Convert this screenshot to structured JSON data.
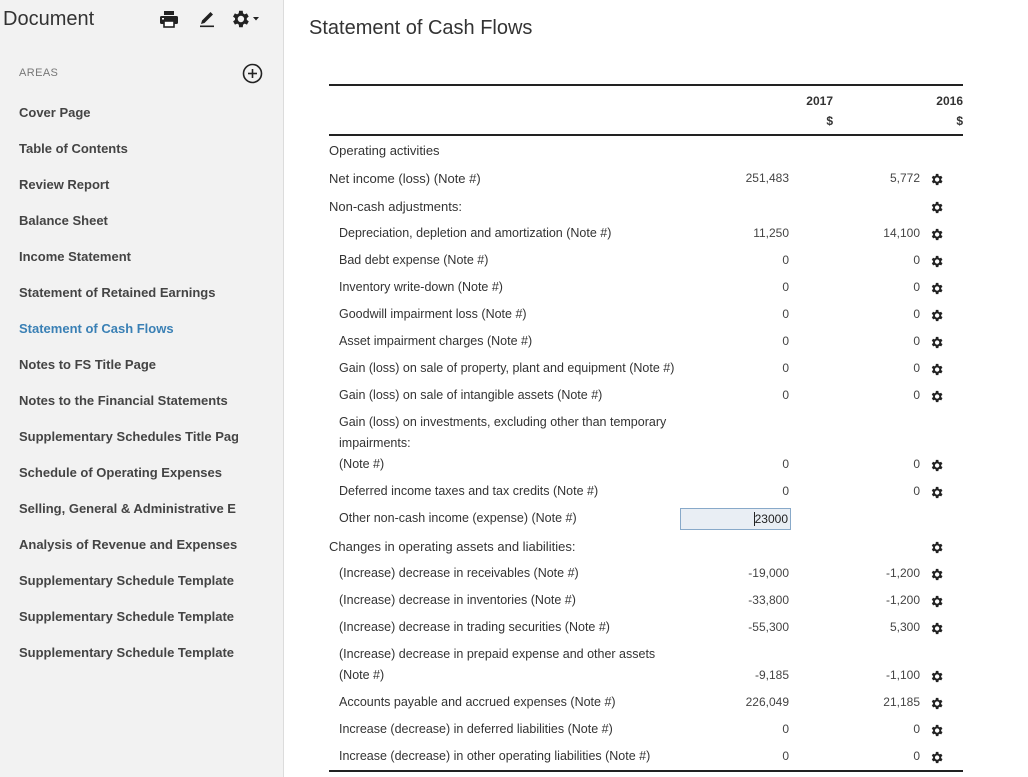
{
  "sidebar": {
    "title": "Document",
    "areas_label": "AREAS",
    "items": [
      {
        "label": "Cover Page"
      },
      {
        "label": "Table of Contents"
      },
      {
        "label": "Review Report"
      },
      {
        "label": "Balance Sheet"
      },
      {
        "label": "Income Statement"
      },
      {
        "label": "Statement of Retained Earnings"
      },
      {
        "label": "Statement of Cash Flows",
        "active": true
      },
      {
        "label": "Notes to FS Title Page"
      },
      {
        "label": "Notes to the Financial Statements"
      },
      {
        "label": "Supplementary Schedules Title Pag"
      },
      {
        "label": "Schedule of Operating Expenses"
      },
      {
        "label": "Selling, General & Administrative E"
      },
      {
        "label": "Analysis of Revenue and Expenses"
      },
      {
        "label": "Supplementary Schedule Template"
      },
      {
        "label": "Supplementary Schedule Template"
      },
      {
        "label": "Supplementary Schedule Template"
      }
    ],
    "icons": [
      "print-icon",
      "edit-pencil-icon",
      "settings-gear-icon",
      "add-circle-icon"
    ],
    "active_color": "#3a80b5"
  },
  "main": {
    "title": "Statement of Cash Flows",
    "columns": {
      "year1": "2017",
      "currency1": "$",
      "year2": "2016",
      "currency2": "$"
    },
    "rows": [
      {
        "label": "Operating activities",
        "v1": "",
        "v2": "",
        "gear": false
      },
      {
        "label": "Net income (loss) (Note #)",
        "v1": "251,483",
        "v2": "5,772",
        "gear": true
      },
      {
        "label": "Non-cash adjustments:",
        "v1": "",
        "v2": "",
        "gear": true
      },
      {
        "label": "Depreciation, depletion and amortization (Note #)",
        "v1": "11,250",
        "v2": "14,100",
        "gear": true
      },
      {
        "label": "Bad debt expense (Note #)",
        "v1": "0",
        "v2": "0",
        "gear": true
      },
      {
        "label": "Inventory write-down (Note #)",
        "v1": "0",
        "v2": "0",
        "gear": true
      },
      {
        "label": "Goodwill impairment loss (Note #)",
        "v1": "0",
        "v2": "0",
        "gear": true
      },
      {
        "label": "Asset impairment charges (Note #)",
        "v1": "0",
        "v2": "0",
        "gear": true
      },
      {
        "label": "Gain (loss) on sale of property, plant and equipment (Note #)",
        "v1": "0",
        "v2": "0",
        "gear": true
      },
      {
        "label": "Gain (loss) on sale of intangible assets (Note #)",
        "v1": "0",
        "v2": "0",
        "gear": true
      },
      {
        "label1": "Gain (loss) on investments, excluding other than temporary",
        "label2": "impairments:",
        "label3": "(Note #)",
        "v1": "0",
        "v2": "0",
        "gear": true
      },
      {
        "label": "Deferred income taxes and tax credits (Note #)",
        "v1": "0",
        "v2": "0",
        "gear": true
      },
      {
        "label": "Other non-cash income (expense) (Note #)",
        "edit_value": "23000",
        "v2": "",
        "gear": false
      },
      {
        "label": "Changes in operating assets and liabilities:",
        "v1": "",
        "v2": "",
        "gear": true
      },
      {
        "label": "(Increase) decrease in receivables (Note #)",
        "v1": "-19,000",
        "v2": "-1,200",
        "gear": true
      },
      {
        "label": "(Increase) decrease in inventories (Note #)",
        "v1": "-33,800",
        "v2": "-1,200",
        "gear": true
      },
      {
        "label": "(Increase) decrease in trading securities (Note #)",
        "v1": "-55,300",
        "v2": "5,300",
        "gear": true
      },
      {
        "label1": "(Increase) decrease in prepaid expense and other assets",
        "label2": "(Note #)",
        "v1": "-9,185",
        "v2": "-1,100",
        "gear": true
      },
      {
        "label": "Accounts payable and accrued expenses (Note #)",
        "v1": "226,049",
        "v2": "21,185",
        "gear": true
      },
      {
        "label": "Increase (decrease) in deferred liabilities (Note #)",
        "v1": "0",
        "v2": "0",
        "gear": true
      },
      {
        "label": "Increase (decrease) in other operating liabilities (Note #)",
        "v1": "0",
        "v2": "0",
        "gear": true
      }
    ]
  }
}
